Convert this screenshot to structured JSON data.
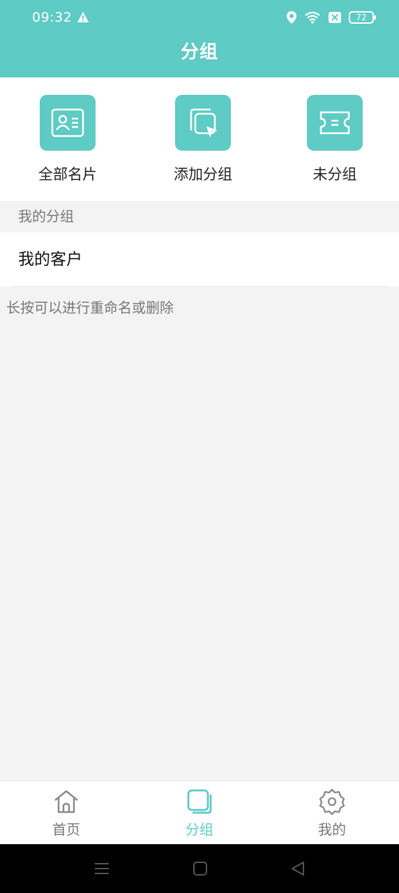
{
  "status_bar": {
    "time": "09:32",
    "battery": "72",
    "icons": [
      "warning-icon",
      "location-icon",
      "wifi-icon",
      "sim-off-icon",
      "battery-icon"
    ]
  },
  "header": {
    "title": "分组"
  },
  "quick_actions": [
    {
      "label": "全部名片",
      "icon": "contact-card-icon"
    },
    {
      "label": "添加分组",
      "icon": "add-group-icon"
    },
    {
      "label": "未分组",
      "icon": "ticket-icon"
    }
  ],
  "section": {
    "title": "我的分组"
  },
  "groups": [
    {
      "name": "我的客户"
    }
  ],
  "hint": "长按可以进行重命名或删除",
  "tabs": [
    {
      "label": "首页",
      "icon": "home-icon",
      "active": false
    },
    {
      "label": "分组",
      "icon": "group-stack-icon",
      "active": true
    },
    {
      "label": "我的",
      "icon": "settings-gear-icon",
      "active": false
    }
  ],
  "colors": {
    "accent": "#5ecbc4",
    "background": "#f3f3f3",
    "text_muted": "#777777"
  }
}
